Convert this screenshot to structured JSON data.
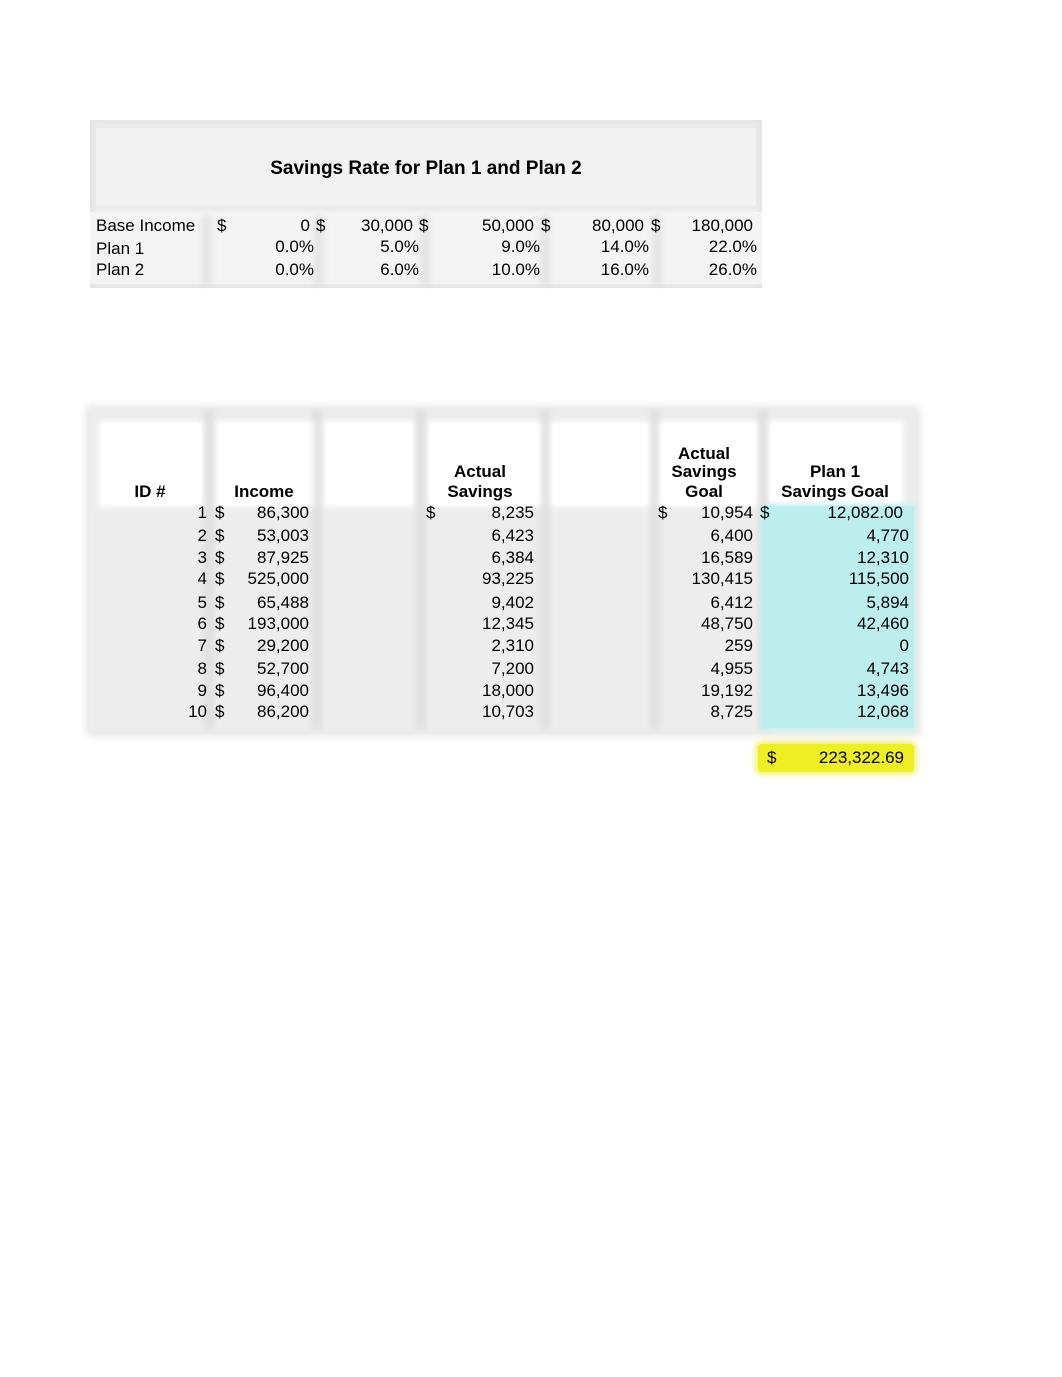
{
  "rates_table": {
    "title": "Savings Rate for Plan 1 and Plan 2",
    "rows": [
      {
        "label": "Base Income",
        "currency": "$",
        "values": [
          "0",
          "30,000",
          "50,000",
          "80,000",
          "180,000"
        ]
      },
      {
        "label": "Plan 1",
        "values": [
          "0.0%",
          "5.0%",
          "9.0%",
          "14.0%",
          "22.0%"
        ]
      },
      {
        "label": "Plan 2",
        "values": [
          "0.0%",
          "6.0%",
          "10.0%",
          "16.0%",
          "26.0%"
        ]
      }
    ]
  },
  "main_table": {
    "headers": {
      "id": "ID #",
      "income": "Income",
      "actual_savings_1": "Actual",
      "actual_savings_2": "Savings",
      "goal_1": "Actual",
      "goal_2": "Savings",
      "goal_3": "Goal",
      "plan1_1": "Plan 1",
      "plan1_2": "Savings Goal"
    },
    "currency": "$",
    "rows": [
      {
        "id": "1",
        "income": "86,300",
        "actual_savings": "8,235",
        "actual_goal": "10,954",
        "plan1_goal": "12,082.00"
      },
      {
        "id": "2",
        "income": "53,003",
        "actual_savings": "6,423",
        "actual_goal": "6,400",
        "plan1_goal": "4,770"
      },
      {
        "id": "3",
        "income": "87,925",
        "actual_savings": "6,384",
        "actual_goal": "16,589",
        "plan1_goal": "12,310"
      },
      {
        "id": "4",
        "income": "525,000",
        "actual_savings": "93,225",
        "actual_goal": "130,415",
        "plan1_goal": "115,500"
      },
      {
        "id": "5",
        "income": "65,488",
        "actual_savings": "9,402",
        "actual_goal": "6,412",
        "plan1_goal": "5,894"
      },
      {
        "id": "6",
        "income": "193,000",
        "actual_savings": "12,345",
        "actual_goal": "48,750",
        "plan1_goal": "42,460"
      },
      {
        "id": "7",
        "income": "29,200",
        "actual_savings": "2,310",
        "actual_goal": "259",
        "plan1_goal": "0"
      },
      {
        "id": "8",
        "income": "52,700",
        "actual_savings": "7,200",
        "actual_goal": "4,955",
        "plan1_goal": "4,743"
      },
      {
        "id": "9",
        "income": "96,400",
        "actual_savings": "18,000",
        "actual_goal": "19,192",
        "plan1_goal": "13,496"
      },
      {
        "id": "10",
        "income": "86,200",
        "actual_savings": "10,703",
        "actual_goal": "8,725",
        "plan1_goal": "12,068"
      }
    ],
    "total": {
      "currency": "$",
      "value": "223,322.69"
    }
  },
  "colors": {
    "plan1_highlight": "#bdeeee",
    "total_highlight": "#eeee22",
    "cell_grey": "#ededed"
  }
}
